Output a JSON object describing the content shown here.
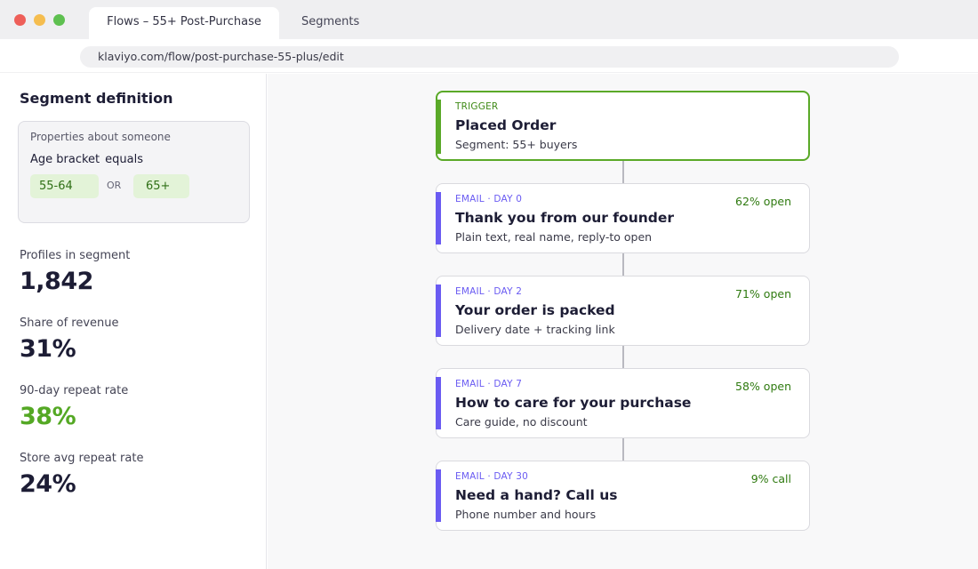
{
  "browser": {
    "tabs": [
      {
        "label": "Flows – 55+ Post-Purchase",
        "active": true
      },
      {
        "label": "Segments",
        "active": false
      }
    ],
    "url": "klaviyo.com/flow/post-purchase-55-plus/edit"
  },
  "sidebar": {
    "title": "Segment definition",
    "condition": {
      "label": "Properties about someone",
      "property": "Age bracket",
      "operator": "equals",
      "values": [
        "55-64",
        "65+"
      ],
      "joiner": "OR"
    },
    "stats": [
      {
        "label": "Profiles in segment",
        "value": "1,842",
        "highlight": false
      },
      {
        "label": "Share of revenue",
        "value": "31%",
        "highlight": false
      },
      {
        "label": "90-day repeat rate",
        "value": "38%",
        "highlight": true
      },
      {
        "label": "Store avg repeat rate",
        "value": "24%",
        "highlight": false
      }
    ]
  },
  "flow": {
    "nodes": [
      {
        "kicker": "TRIGGER",
        "title": "Placed Order",
        "subtitle": "Segment: 55+ buyers",
        "metric": ""
      },
      {
        "kicker": "EMAIL · DAY 0",
        "title": "Thank you from our founder",
        "subtitle": "Plain text, real name, reply-to open",
        "metric": "62% open"
      },
      {
        "kicker": "EMAIL · DAY 2",
        "title": "Your order is packed",
        "subtitle": "Delivery date + tracking link",
        "metric": "71% open"
      },
      {
        "kicker": "EMAIL · DAY 7",
        "title": "How to care for your purchase",
        "subtitle": "Care guide, no discount",
        "metric": "58% open"
      },
      {
        "kicker": "EMAIL · DAY 30",
        "title": "Need a hand? Call us",
        "subtitle": "Phone number and hours",
        "metric": "9% call"
      }
    ]
  },
  "colors": {
    "accent_green": "#5aa928",
    "email_purple": "#6a5bf2",
    "metric_green": "#2f7a10",
    "pill_bg": "#e3f3d8"
  }
}
